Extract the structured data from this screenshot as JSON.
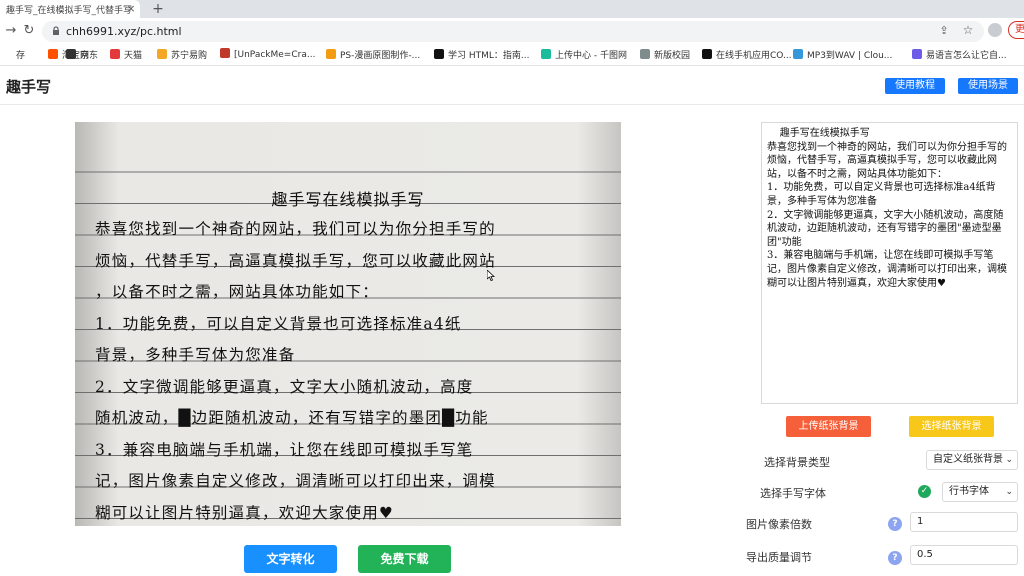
{
  "browser": {
    "tab_title": "趣手写_在线模拟手写_代替手写",
    "url": "chh6991.xyz/pc.html",
    "update_label": "更",
    "bookmarks": [
      {
        "label": "存",
        "color": "#ffffff"
      },
      {
        "label": "淘宝网",
        "color": "#ff5000"
      },
      {
        "label": "京东",
        "color": "#333333"
      },
      {
        "label": "天猫",
        "color": "#e4393c"
      },
      {
        "label": "苏宁易购",
        "color": "#f5a623"
      },
      {
        "label": "[UnPackMe=Cra...",
        "color": "#c0392b"
      },
      {
        "label": "PS-漫画原图制作-...",
        "color": "#f39c12"
      },
      {
        "label": "学习 HTML：指南...",
        "color": "#111111"
      },
      {
        "label": "上传中心 - 千图网",
        "color": "#1abc9c"
      },
      {
        "label": "新版校园",
        "color": "#7f8c8d"
      },
      {
        "label": "在线手机应用CO...",
        "color": "#111111"
      },
      {
        "label": "MP3到WAV | Clou...",
        "color": "#3498db"
      },
      {
        "label": "易语言怎么让它自...",
        "color": "#6c5ce7"
      }
    ]
  },
  "header": {
    "logo": "趣手写",
    "tutorial_label": "使用教程",
    "scenario_label": "使用场景"
  },
  "preview": {
    "title": "趣手写在线模拟手写",
    "lines": [
      "恭喜您找到一个神奇的网站，我们可以为你分担手写的",
      "烦恼，代替手写，高逼真模拟手写，您可以收藏此网站",
      "，以备不时之需，网站具体功能如下：",
      "  1．功能免费，可以自定义背景也可选择标准a4纸",
      "背景，多种手写体为您准备",
      "  2．文字微调能够更逼真，文字大小随机波动，高度",
      "随机波动，█边距随机波动，还有写错字的墨团█功能",
      "  3．兼容电脑端与手机端，让您在线即可模拟手写笔",
      "记，图片像素自定义修改，调清晰可以打印出来，调模",
      "糊可以让图片特别逼真，欢迎大家使用♥"
    ]
  },
  "actions": {
    "convert_label": "文字转化",
    "download_label": "免费下载"
  },
  "editor": {
    "text": "    趣手写在线模拟手写\n恭喜您找到一个神奇的网站，我们可以为你分担手写的烦恼，代替手写，高逼真模拟手写，您可以收藏此网站，以备不时之需，网站具体功能如下：\n1．功能免费，可以自定义背景也可选择标准a4纸背景，多种手写体为您准备\n2．文字微调能够更逼真，文字大小随机波动，高度随机波动，边距随机波动，还有写错字的墨团\"墨迹型墨团\"功能\n3．兼容电脑端与手机端，让您在线即可模拟手写笔记，图片像素自定义修改，调清晰可以打印出来，调模糊可以让图片特别逼真，欢迎大家使用♥"
  },
  "settings": {
    "upload_bg_label": "上传纸张背景",
    "choose_bg_label": "选择纸张背景",
    "bg_type_label": "选择背景类型",
    "bg_type_value": "自定义纸张背景",
    "font_label": "选择手写字体",
    "font_value": "行书字体",
    "pixel_ratio_label": "图片像素倍数",
    "pixel_ratio_value": "1",
    "quality_label": "导出质量调节",
    "quality_value": "0.5",
    "help_glyph": "?"
  },
  "colors": {
    "primary": "#1677ff",
    "success": "#22b358",
    "upload": "#f5603b",
    "choose": "#f7c71a"
  }
}
